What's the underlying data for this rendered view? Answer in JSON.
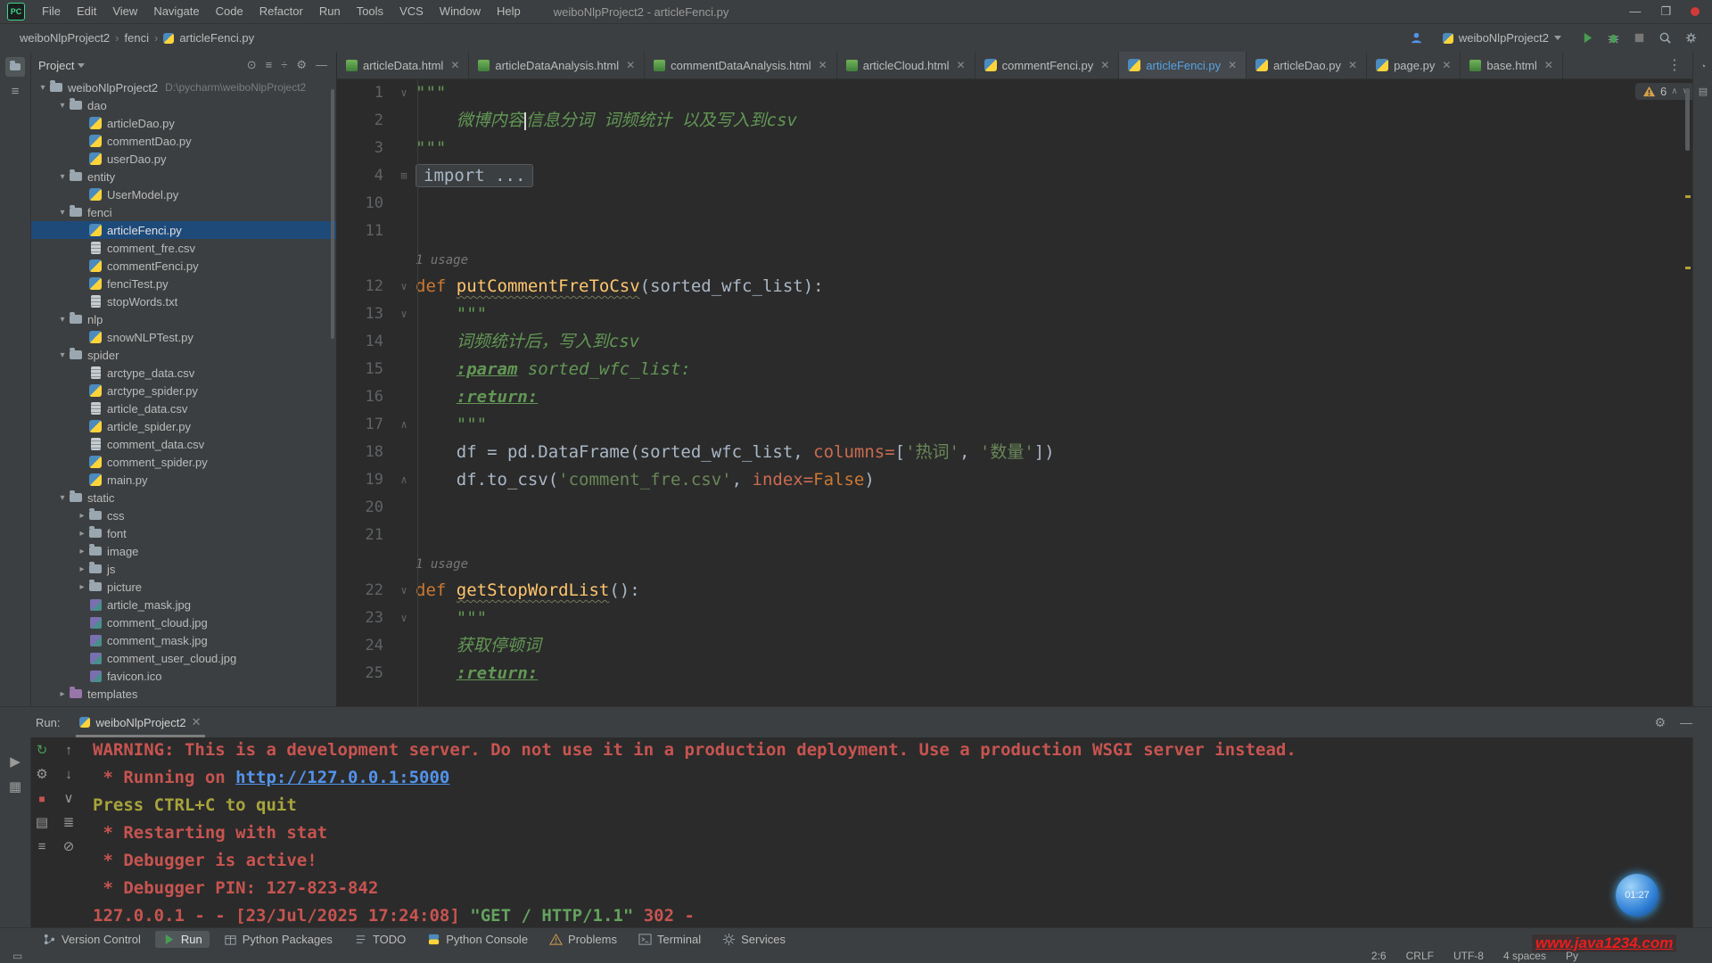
{
  "window": {
    "title": "weiboNlpProject2 - articleFenci.py",
    "menus": [
      "File",
      "Edit",
      "View",
      "Navigate",
      "Code",
      "Refactor",
      "Run",
      "Tools",
      "VCS",
      "Window",
      "Help"
    ],
    "controls": {
      "minimize": "—",
      "maximize": "❐"
    }
  },
  "breadcrumb": {
    "items": [
      "weiboNlpProject2",
      "fenci",
      "articleFenci.py"
    ]
  },
  "toolbar_right": {
    "run_config": "weiboNlpProject2"
  },
  "project_panel": {
    "title": "Project",
    "tree": [
      {
        "label": "weiboNlpProject2",
        "type": "folder",
        "depth": 0,
        "chev": "open",
        "path": "D:\\pycharm\\weiboNlpProject2"
      },
      {
        "label": "dao",
        "type": "folder",
        "depth": 1,
        "chev": "open"
      },
      {
        "label": "articleDao.py",
        "type": "py",
        "depth": 2
      },
      {
        "label": "commentDao.py",
        "type": "py",
        "depth": 2
      },
      {
        "label": "userDao.py",
        "type": "py",
        "depth": 2
      },
      {
        "label": "entity",
        "type": "folder",
        "depth": 1,
        "chev": "open"
      },
      {
        "label": "UserModel.py",
        "type": "py",
        "depth": 2
      },
      {
        "label": "fenci",
        "type": "folder",
        "depth": 1,
        "chev": "open"
      },
      {
        "label": "articleFenci.py",
        "type": "py",
        "depth": 2,
        "selected": true
      },
      {
        "label": "comment_fre.csv",
        "type": "csv",
        "depth": 2
      },
      {
        "label": "commentFenci.py",
        "type": "py",
        "depth": 2
      },
      {
        "label": "fenciTest.py",
        "type": "py",
        "depth": 2
      },
      {
        "label": "stopWords.txt",
        "type": "txt",
        "depth": 2
      },
      {
        "label": "nlp",
        "type": "folder",
        "depth": 1,
        "chev": "open"
      },
      {
        "label": "snowNLPTest.py",
        "type": "py",
        "depth": 2
      },
      {
        "label": "spider",
        "type": "folder",
        "depth": 1,
        "chev": "open"
      },
      {
        "label": "arctype_data.csv",
        "type": "csv",
        "depth": 2
      },
      {
        "label": "arctype_spider.py",
        "type": "py",
        "depth": 2
      },
      {
        "label": "article_data.csv",
        "type": "csv",
        "depth": 2
      },
      {
        "label": "article_spider.py",
        "type": "py",
        "depth": 2
      },
      {
        "label": "comment_data.csv",
        "type": "csv",
        "depth": 2
      },
      {
        "label": "comment_spider.py",
        "type": "py",
        "depth": 2
      },
      {
        "label": "main.py",
        "type": "py",
        "depth": 2
      },
      {
        "label": "static",
        "type": "folder",
        "depth": 1,
        "chev": "open"
      },
      {
        "label": "css",
        "type": "folder",
        "depth": 2,
        "chev": "closed"
      },
      {
        "label": "font",
        "type": "folder",
        "depth": 2,
        "chev": "closed"
      },
      {
        "label": "image",
        "type": "folder",
        "depth": 2,
        "chev": "closed"
      },
      {
        "label": "js",
        "type": "folder",
        "depth": 2,
        "chev": "closed"
      },
      {
        "label": "picture",
        "type": "folder",
        "depth": 2,
        "chev": "closed"
      },
      {
        "label": "article_mask.jpg",
        "type": "img",
        "depth": 2
      },
      {
        "label": "comment_cloud.jpg",
        "type": "img",
        "depth": 2
      },
      {
        "label": "comment_mask.jpg",
        "type": "img",
        "depth": 2
      },
      {
        "label": "comment_user_cloud.jpg",
        "type": "img",
        "depth": 2
      },
      {
        "label": "favicon.ico",
        "type": "img",
        "depth": 2
      },
      {
        "label": "templates",
        "type": "folder-purple",
        "depth": 1,
        "chev": "closed"
      }
    ]
  },
  "tabs": [
    {
      "label": "articleData.html",
      "type": "html"
    },
    {
      "label": "articleDataAnalysis.html",
      "type": "html"
    },
    {
      "label": "commentDataAnalysis.html",
      "type": "html"
    },
    {
      "label": "articleCloud.html",
      "type": "html"
    },
    {
      "label": "commentFenci.py",
      "type": "py"
    },
    {
      "label": "articleFenci.py",
      "type": "py",
      "active": true
    },
    {
      "label": "articleDao.py",
      "type": "py"
    },
    {
      "label": "page.py",
      "type": "py"
    },
    {
      "label": "base.html",
      "type": "html"
    }
  ],
  "editor": {
    "inspection_count": "6",
    "usage_label": "1 usage",
    "lines": [
      {
        "num": "1",
        "fold": "v",
        "indent": 0,
        "seg": [
          [
            "\"\"\"",
            "doc"
          ]
        ]
      },
      {
        "num": "2",
        "indent": 1,
        "seg": [
          [
            "微博内容",
            "docit"
          ],
          [
            "",
            "caret"
          ],
          [
            "信息分词 词频统计 以及写入到csv",
            "docit"
          ]
        ]
      },
      {
        "num": "3",
        "indent": 0,
        "seg": [
          [
            "\"\"\"",
            "doc"
          ]
        ]
      },
      {
        "num": "4",
        "fold": "+",
        "indent": 0,
        "seg": [
          [
            "import ...",
            "fold"
          ]
        ]
      },
      {
        "num": "10",
        "indent": 0,
        "seg": []
      },
      {
        "num": "11",
        "indent": 0,
        "seg": []
      },
      {
        "usage": true
      },
      {
        "num": "12",
        "fold": "v",
        "indent": 0,
        "seg": [
          [
            "def ",
            "kw"
          ],
          [
            "putCommentFreToCsv",
            "fn"
          ],
          [
            "(sorted_wfc_list):",
            "plain"
          ]
        ]
      },
      {
        "num": "13",
        "fold": "v",
        "indent": 1,
        "seg": [
          [
            "\"\"\"",
            "doc"
          ]
        ]
      },
      {
        "num": "14",
        "indent": 1,
        "seg": [
          [
            "词频统计后，写入到csv",
            "docit"
          ]
        ]
      },
      {
        "num": "15",
        "indent": 1,
        "seg": [
          [
            ":param",
            "tag"
          ],
          [
            " sorted_wfc_list:",
            "docit"
          ]
        ]
      },
      {
        "num": "16",
        "indent": 1,
        "seg": [
          [
            ":return:",
            "tag"
          ]
        ]
      },
      {
        "num": "17",
        "fold": "^",
        "indent": 1,
        "seg": [
          [
            "\"\"\"",
            "doc"
          ]
        ]
      },
      {
        "num": "18",
        "indent": 1,
        "seg": [
          [
            "df = pd.DataFrame(sorted_wfc_list, ",
            "plain"
          ],
          [
            "columns=",
            "named"
          ],
          [
            "[",
            "plain"
          ],
          [
            "'热词'",
            "str"
          ],
          [
            ", ",
            "plain"
          ],
          [
            "'数量'",
            "str"
          ],
          [
            "])",
            "plain"
          ]
        ]
      },
      {
        "num": "19",
        "fold": "^",
        "indent": 1,
        "seg": [
          [
            "df.to_csv(",
            "plain"
          ],
          [
            "'comment_fre.csv'",
            "str"
          ],
          [
            ", ",
            "plain"
          ],
          [
            "index=",
            "named"
          ],
          [
            "False",
            "const"
          ],
          [
            ")",
            "plain"
          ]
        ]
      },
      {
        "num": "20",
        "indent": 0,
        "seg": []
      },
      {
        "num": "21",
        "indent": 0,
        "seg": []
      },
      {
        "usage": true
      },
      {
        "num": "22",
        "fold": "v",
        "indent": 0,
        "seg": [
          [
            "def ",
            "kw"
          ],
          [
            "getStopWordList",
            "fn"
          ],
          [
            "():",
            "plain"
          ]
        ]
      },
      {
        "num": "23",
        "fold": "v",
        "indent": 1,
        "seg": [
          [
            "\"\"\"",
            "doc"
          ]
        ]
      },
      {
        "num": "24",
        "indent": 1,
        "seg": [
          [
            "获取停顿词",
            "docit"
          ]
        ]
      },
      {
        "num": "25",
        "indent": 1,
        "seg": [
          [
            ":return:",
            "tag"
          ]
        ]
      }
    ]
  },
  "run_panel": {
    "label": "Run:",
    "tab": "weiboNlpProject2",
    "console": [
      [
        [
          "WARNING: This is a development server. Do not use it in a production deployment. Use a production WSGI server instead.",
          "err"
        ]
      ],
      [
        [
          " * Running on ",
          "err"
        ],
        [
          "http://127.0.0.1:5000",
          "link"
        ]
      ],
      [
        [
          "Press CTRL+C to quit",
          "warn"
        ]
      ],
      [
        [
          " * Restarting with stat",
          "err"
        ]
      ],
      [
        [
          " * Debugger is active!",
          "err"
        ]
      ],
      [
        [
          " * Debugger PIN: 127-823-842",
          "err"
        ]
      ],
      [
        [
          "127.0.0.1 - - [23/Jul/2025 17:24:08] ",
          "err"
        ],
        [
          "\"GET / HTTP/1.1\"",
          "ok"
        ],
        [
          " 302 -",
          "err"
        ]
      ]
    ]
  },
  "tool_window_bar": [
    {
      "label": "Version Control",
      "icon": "branch"
    },
    {
      "label": "Run",
      "icon": "play",
      "active": true
    },
    {
      "label": "Python Packages",
      "icon": "package"
    },
    {
      "label": "TODO",
      "icon": "todo"
    },
    {
      "label": "Python Console",
      "icon": "python"
    },
    {
      "label": "Problems",
      "icon": "problems"
    },
    {
      "label": "Terminal",
      "icon": "terminal"
    },
    {
      "label": "Services",
      "icon": "services"
    }
  ],
  "status_bar": {
    "items": [
      "2:6",
      "CRLF",
      "UTF-8",
      "4 spaces",
      "Py"
    ]
  },
  "watermark": "www.java1234.com",
  "timer_badge": "01:27",
  "colors": {
    "accent_blue": "#56a2e5",
    "error_red": "#c75450",
    "string_green": "#6a8759",
    "keyword_orange": "#cc7832"
  }
}
